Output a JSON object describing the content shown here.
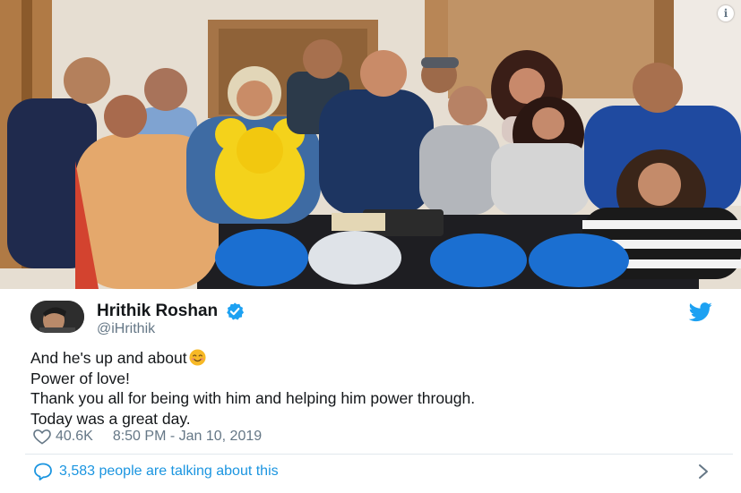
{
  "tweet": {
    "author_name": "Hrithik Roshan",
    "handle": "@iHrithik",
    "lines": [
      "And he's up and about",
      "Power of love!",
      "Thank you all for being with him and helping him power through.",
      "Today was a great day."
    ],
    "likes": "40.6K",
    "timestamp": "8:50 PM - Jan 10, 2019",
    "conversation": "3,583 people are talking about this"
  },
  "colors": {
    "twitter_blue": "#1da1f2",
    "link_blue": "#1b95e0",
    "muted_text": "#657786",
    "divider": "#e1e8ed"
  },
  "icons": {
    "info": "info-icon",
    "verified": "verified-badge-icon",
    "twitter": "twitter-bird-icon",
    "emoji": "smiling-face-emoji",
    "like": "heart-icon",
    "reply": "speech-bubble-icon",
    "more": "chevron-right-icon"
  }
}
